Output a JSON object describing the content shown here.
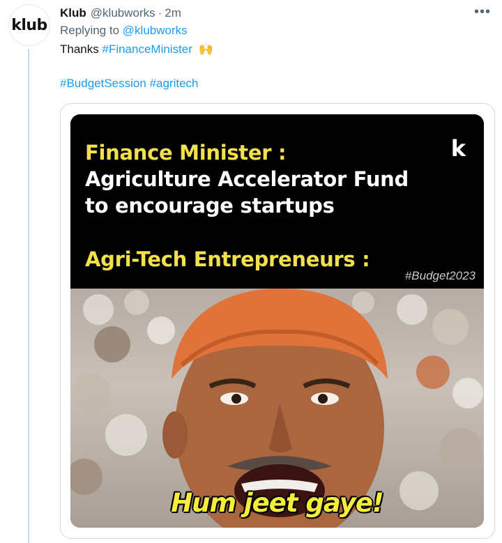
{
  "tweet": {
    "avatar_text": "klub",
    "author_name": "Klub",
    "author_handle": "@klubworks",
    "separator": "·",
    "time": "2m",
    "more_icon": "more-horizontal-icon",
    "more_glyph": "•••",
    "replying_prefix": "Replying to",
    "replying_to": "@klubworks",
    "text_prefix": "Thanks",
    "hashtag_1": "#FinanceMinister",
    "emoji": "🙌",
    "hashtag_2": "#BudgetSession",
    "hashtag_3": "#agritech"
  },
  "media": {
    "line1": "Finance Minister :",
    "line2": "Agriculture Accelerator Fund",
    "line3": "to encourage startups",
    "line4": "Agri-Tech Entrepreneurs :",
    "logo": "k",
    "tag": "#Budget2023",
    "caption": "Hum jeet gaye!"
  },
  "colors": {
    "link": "#1d9bf0",
    "meme_yellow": "#f3e04a",
    "caption_yellow": "#f6ec3c",
    "turban_orange": "#e0733a"
  }
}
